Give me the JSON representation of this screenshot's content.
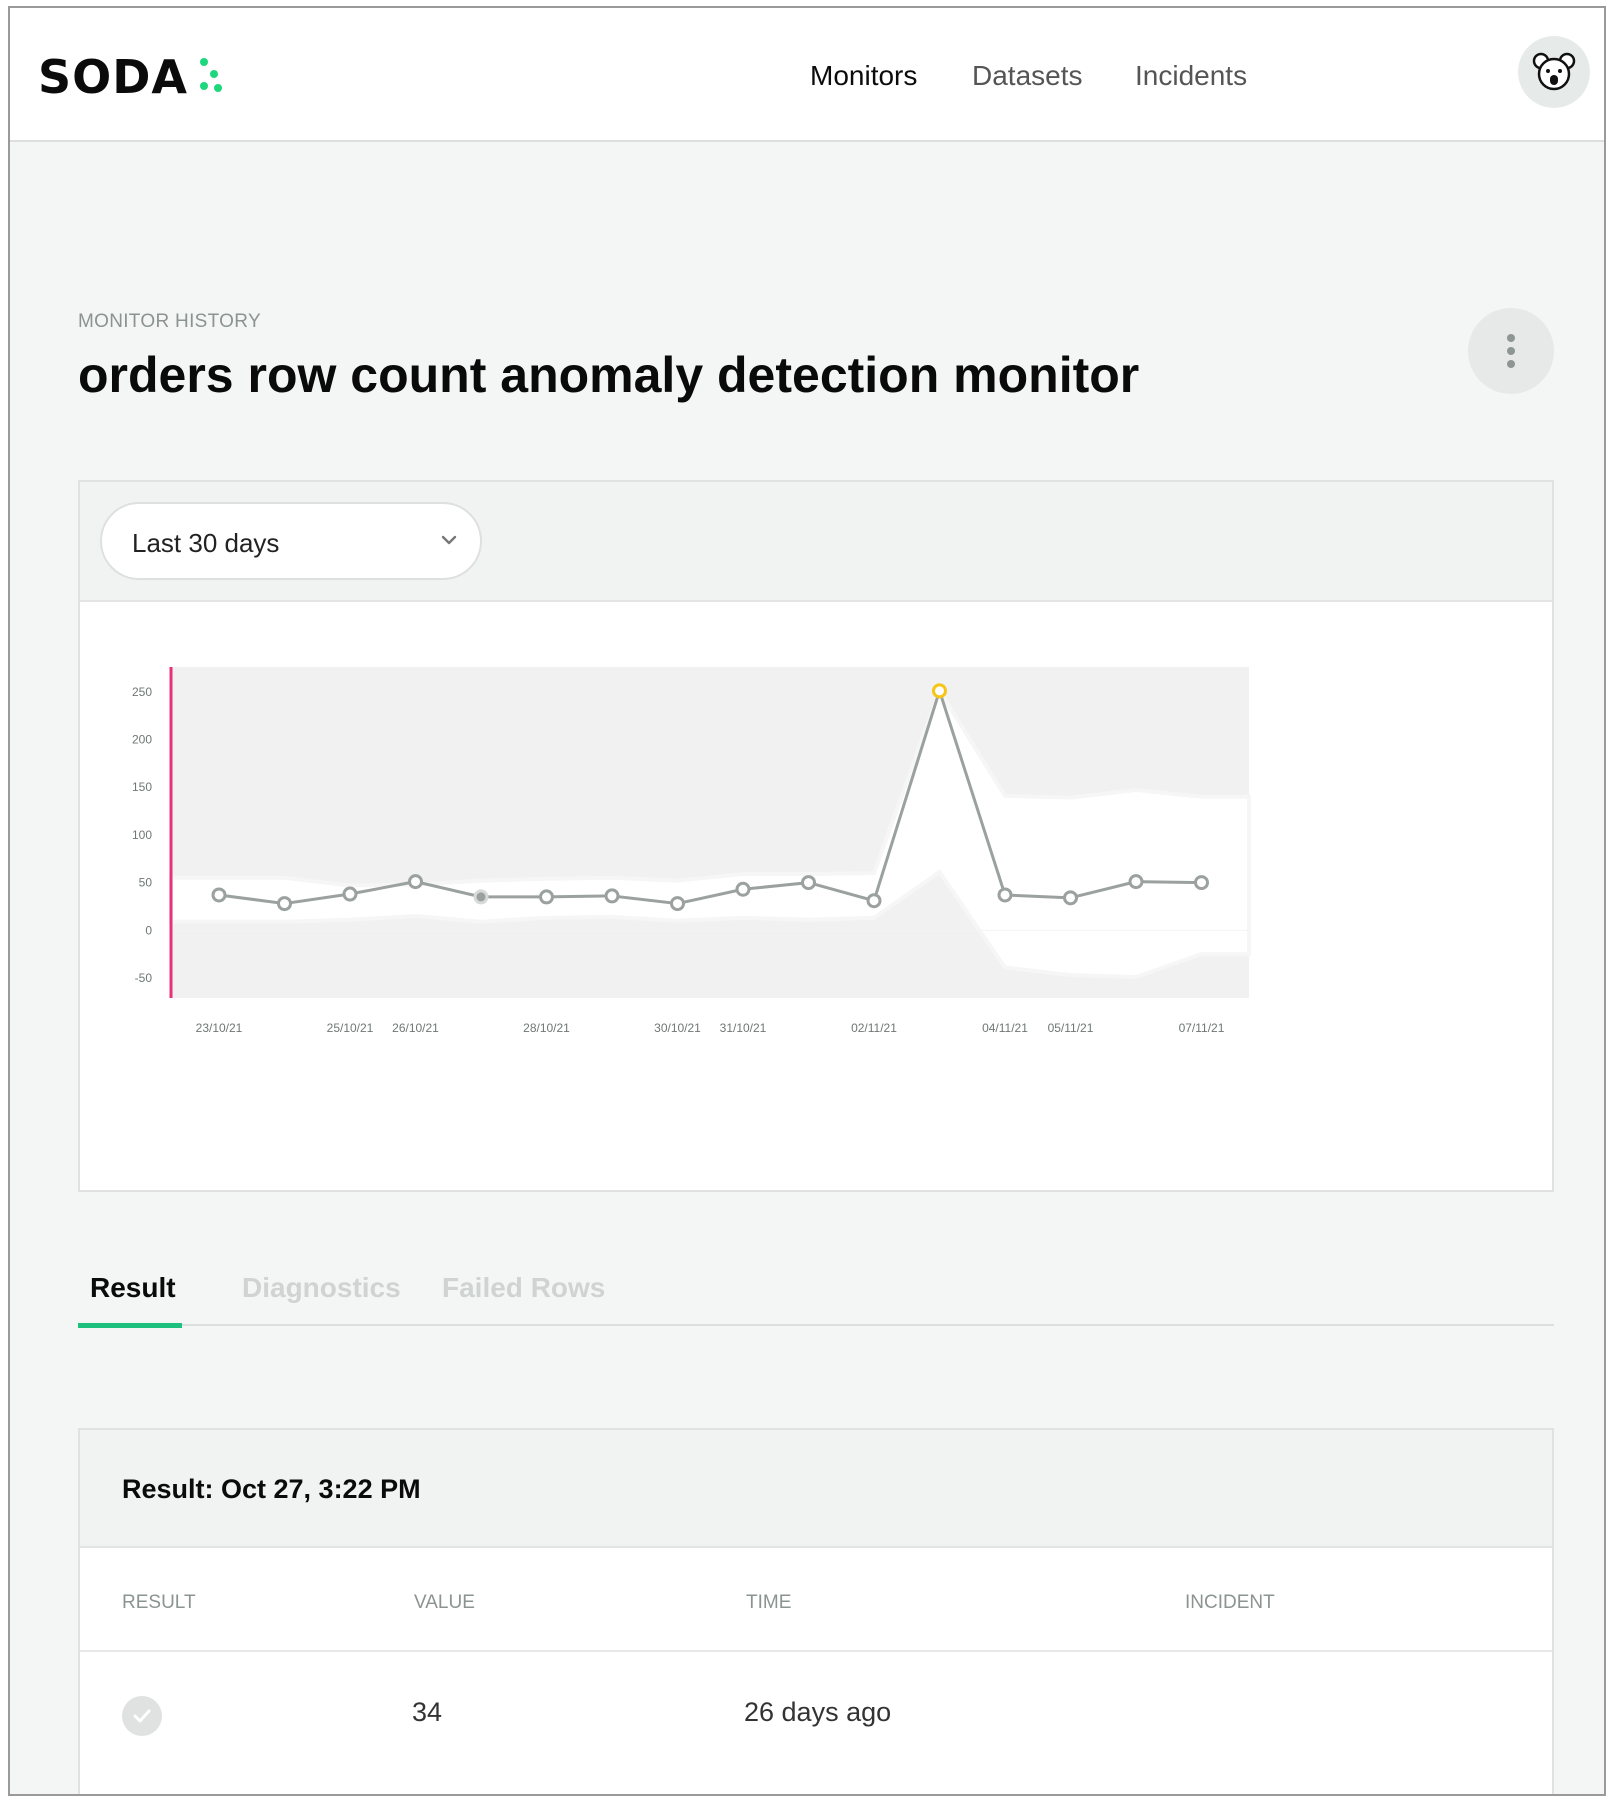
{
  "app": {
    "logo_text": "SODA",
    "logo_dot_color": "#1ed67b",
    "nav": [
      {
        "label": "Monitors",
        "active": true
      },
      {
        "label": "Datasets",
        "active": false
      },
      {
        "label": "Incidents",
        "active": false
      }
    ],
    "avatar_icon": "koala-icon"
  },
  "page": {
    "eyebrow": "MONITOR HISTORY",
    "title": "orders row count anomaly detection monitor",
    "more_icon": "more-vertical-icon"
  },
  "chart_panel": {
    "range_selected": "Last 30 days",
    "range_icon": "chevron-down-icon"
  },
  "chart_data": {
    "type": "line",
    "x": [
      "23/10/21",
      "24/10/21",
      "25/10/21",
      "26/10/21",
      "27/10/21",
      "28/10/21",
      "29/10/21",
      "30/10/21",
      "31/10/21",
      "01/11/21",
      "02/11/21",
      "03/11/21",
      "04/11/21",
      "05/11/21",
      "06/11/21",
      "07/11/21"
    ],
    "x_tick_labels": [
      "23/10/21",
      "25/10/21",
      "26/10/21",
      "28/10/21",
      "30/10/21",
      "31/10/21",
      "02/11/21",
      "04/11/21",
      "05/11/21",
      "07/11/21"
    ],
    "series": [
      {
        "values": [
          36,
          27,
          37,
          50,
          34,
          34,
          35,
          27,
          42,
          49,
          30,
          250,
          36,
          33,
          50,
          49
        ],
        "color": "#9aa19f",
        "anomaly_index": 11,
        "anomaly_color": "#f5c518",
        "selected_index": 4
      }
    ],
    "band_upper": [
      54,
      54,
      46,
      47,
      51,
      53,
      54,
      51,
      58,
      58,
      59,
      250,
      140,
      138,
      146,
      139
    ],
    "band_lower": [
      8,
      8,
      10,
      14,
      8,
      12,
      13,
      9,
      12,
      10,
      12,
      60,
      -40,
      -48,
      -50,
      -26
    ],
    "yticks": [
      250,
      200,
      150,
      100,
      50,
      0,
      -50
    ],
    "ylim": [
      -72,
      275
    ],
    "grid": false,
    "marker_color": "#e8317a"
  },
  "tabs": [
    {
      "label": "Result",
      "active": true
    },
    {
      "label": "Diagnostics",
      "active": false
    },
    {
      "label": "Failed Rows",
      "active": false
    }
  ],
  "result": {
    "title": "Result: Oct 27, 3:22 PM",
    "columns": [
      "RESULT",
      "VALUE",
      "TIME",
      "INCIDENT"
    ],
    "row": {
      "status_icon": "check-circle-icon",
      "value": "34",
      "time": "26 days ago",
      "incident": ""
    }
  }
}
